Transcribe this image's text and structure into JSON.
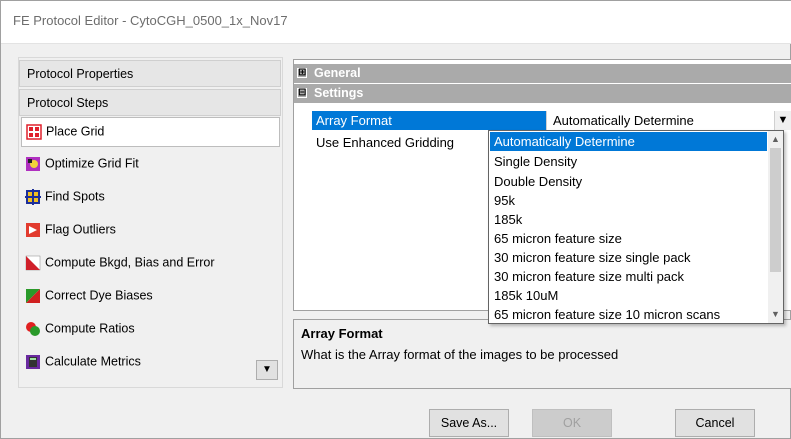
{
  "window": {
    "title": "FE Protocol Editor - CytoCGH_0500_1x_Nov17"
  },
  "sidebar": {
    "sections": [
      {
        "label": "Protocol Properties"
      },
      {
        "label": "Protocol Steps"
      }
    ],
    "steps": [
      {
        "label": "Place Grid",
        "icon": "place-grid-icon",
        "color": "#e0202c",
        "selected": true
      },
      {
        "label": "Optimize Grid Fit",
        "icon": "optimize-grid-fit-icon",
        "color": "#b030c0"
      },
      {
        "label": "Find Spots",
        "icon": "find-spots-icon",
        "color": "#1d2f9a"
      },
      {
        "label": "Flag Outliers",
        "icon": "flag-outliers-icon",
        "color": "#e23b2e"
      },
      {
        "label": "Compute Bkgd, Bias and Error",
        "icon": "compute-bkgd-icon",
        "color": "#d0202a"
      },
      {
        "label": "Correct Dye Biases",
        "icon": "correct-dye-biases-icon",
        "color": "#2a9a2a"
      },
      {
        "label": "Compute Ratios",
        "icon": "compute-ratios-icon",
        "color": "#e02020"
      },
      {
        "label": "Calculate Metrics",
        "icon": "calculate-metrics-icon",
        "color": "#6a2aa0"
      }
    ]
  },
  "grid": {
    "categories": [
      {
        "label": "General",
        "expander": "⊞"
      },
      {
        "label": "Settings",
        "expander": "⊟"
      }
    ],
    "properties": [
      {
        "name": "Array Format",
        "value": "Automatically Determine",
        "selected": true
      },
      {
        "name": "Use Enhanced Gridding",
        "value": ""
      }
    ]
  },
  "dropdown": {
    "options": [
      {
        "label": "Automatically Determine",
        "selected": true
      },
      {
        "label": "Single Density"
      },
      {
        "label": "Double Density"
      },
      {
        "label": "95k"
      },
      {
        "label": "185k"
      },
      {
        "label": "65 micron feature size"
      },
      {
        "label": "30 micron feature size single pack"
      },
      {
        "label": "30 micron feature size multi pack"
      },
      {
        "label": "185k 10uM"
      },
      {
        "label": "65 micron feature size 10 micron scans"
      }
    ]
  },
  "description": {
    "title": "Array Format",
    "text": "What is the Array format of the images to be processed"
  },
  "buttons": {
    "save_as": "Save As...",
    "ok": "OK",
    "cancel": "Cancel"
  }
}
